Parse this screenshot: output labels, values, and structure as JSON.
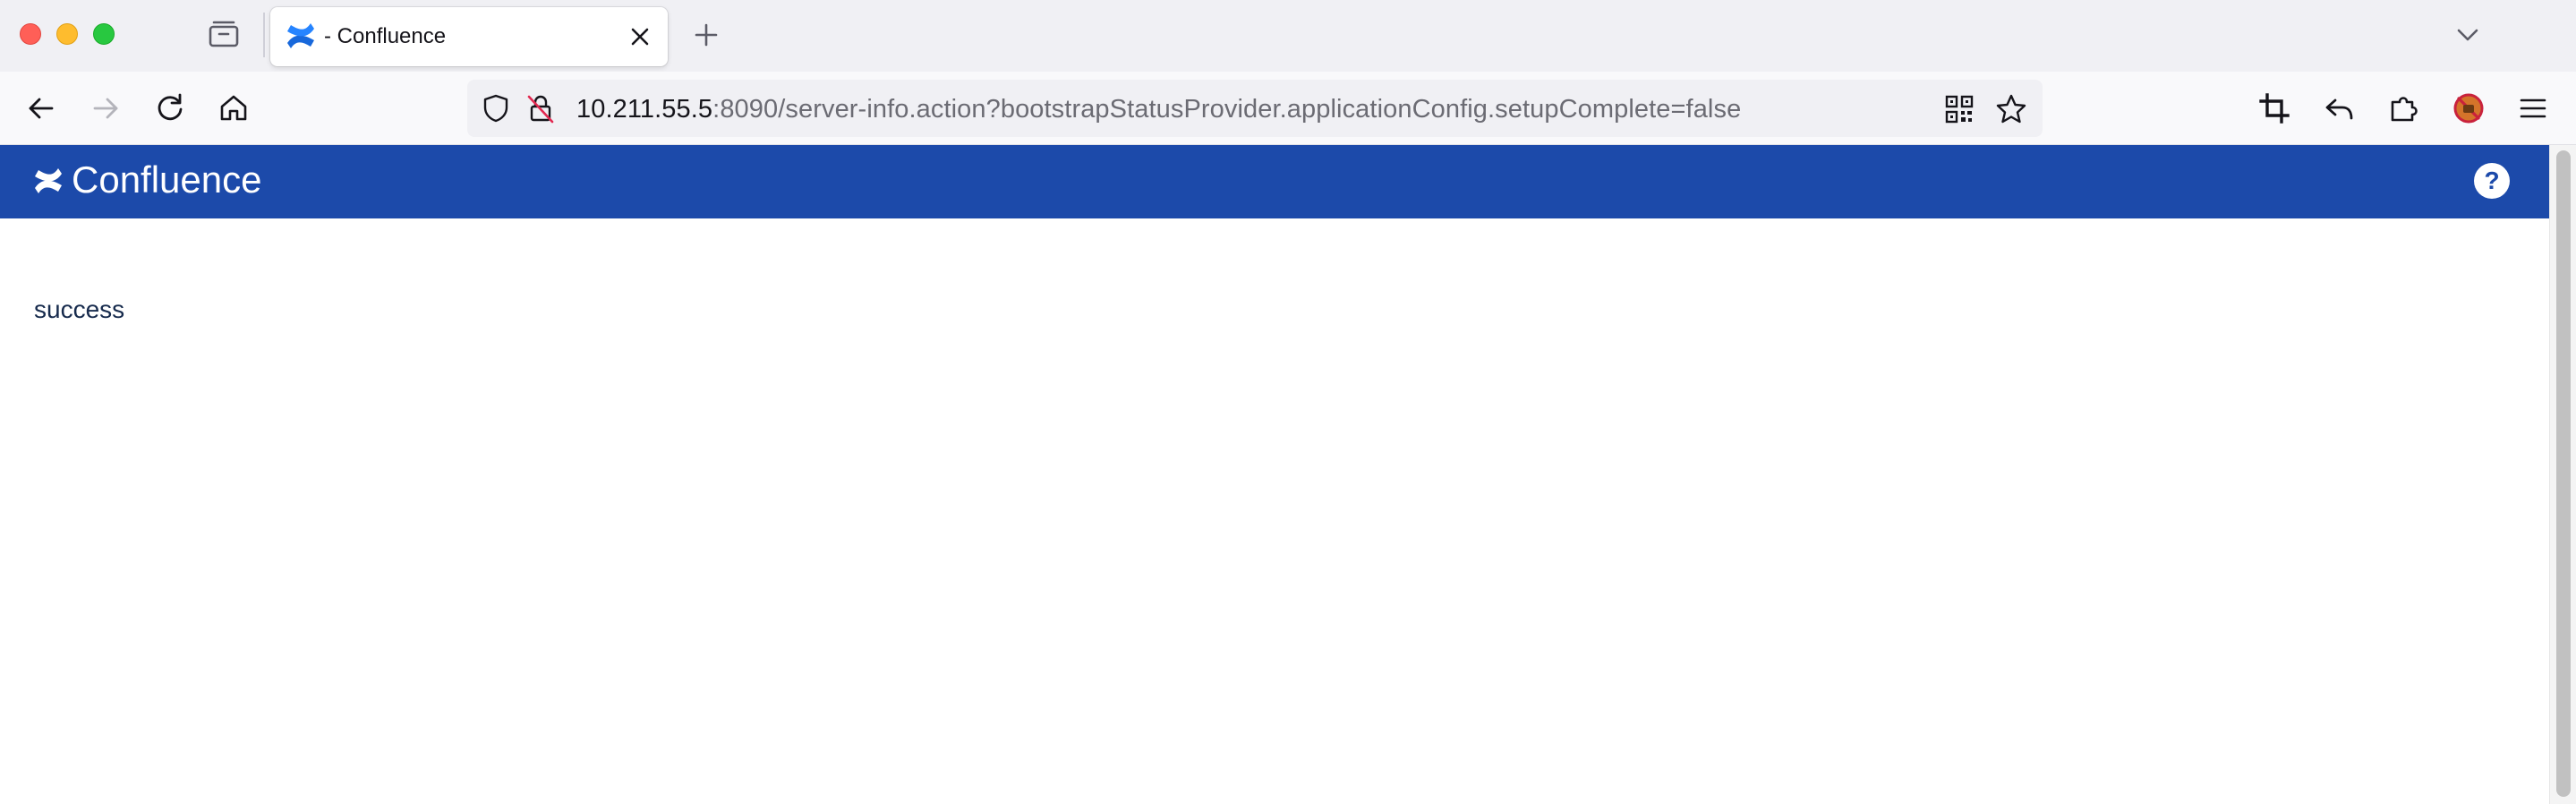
{
  "browser": {
    "tab": {
      "title": "- Confluence",
      "favicon": "confluence-logo-icon"
    },
    "url": {
      "host": "10.211.55.5",
      "rest": ":8090/server-info.action?bootstrapStatusProvider.applicationConfig.setupComplete=false"
    },
    "nav_icons": [
      "back-icon",
      "forward-icon",
      "reload-icon",
      "home-icon"
    ],
    "toolbar_icons": [
      "screenshot-crop-icon",
      "undo-icon",
      "extensions-icon",
      "blocked-addon-icon",
      "menu-icon"
    ]
  },
  "app": {
    "brand": "Confluence",
    "header_color": "#1c4aaa",
    "help_icon": "help-icon"
  },
  "content": {
    "status": "success"
  }
}
